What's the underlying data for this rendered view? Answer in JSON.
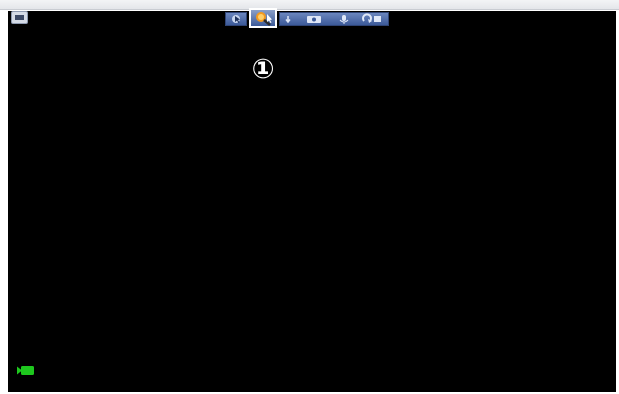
{
  "toolbar": {
    "buttons": [
      {
        "icon": "pointer-icon"
      },
      {
        "icon": "magnifier-icon",
        "state": "selected"
      },
      {
        "icon": "arrow-down-icon"
      },
      {
        "icon": "camera-icon"
      },
      {
        "icon": "microphone-icon"
      },
      {
        "icon": "rotate-icon"
      }
    ]
  },
  "callout": {
    "number": "①"
  },
  "status": {
    "icon": "video-camera-icon",
    "color": "#1ec71e"
  },
  "colors": {
    "video_background": "#000000",
    "toolbar_blue": "#3c5a99",
    "highlight": "#ffffff"
  }
}
